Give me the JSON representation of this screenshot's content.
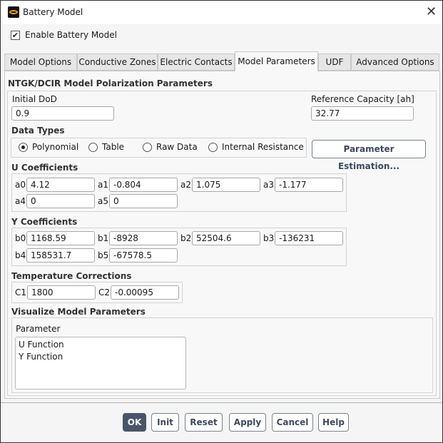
{
  "window": {
    "title": "Battery Model"
  },
  "enable": {
    "label": "Enable Battery Model",
    "checked": true
  },
  "tabs": [
    {
      "label": "Model Options"
    },
    {
      "label": "Conductive Zones"
    },
    {
      "label": "Electric Contacts"
    },
    {
      "label": "Model Parameters",
      "active": true
    },
    {
      "label": "UDF"
    },
    {
      "label": "Advanced Options"
    }
  ],
  "section_title": "NTGK/DCIR Model Polarization Parameters",
  "initial_dod": {
    "label": "Initial DoD",
    "value": "0.9"
  },
  "ref_capacity": {
    "label": "Reference Capacity [ah]",
    "value": "32.77"
  },
  "data_types": {
    "title": "Data Types",
    "options": [
      "Polynomial",
      "Table",
      "Raw Data",
      "Internal Resistance"
    ],
    "selected": "Polynomial"
  },
  "param_est_label": "Parameter Estimation...",
  "u": {
    "title": "U Coefficients",
    "fields": [
      {
        "label": "a0",
        "value": "4.12"
      },
      {
        "label": "a1",
        "value": "-0.804"
      },
      {
        "label": "a2",
        "value": "1.075"
      },
      {
        "label": "a3",
        "value": "-1.177"
      },
      {
        "label": "a4",
        "value": "0"
      },
      {
        "label": "a5",
        "value": "0"
      }
    ]
  },
  "y": {
    "title": "Y Coefficients",
    "fields": [
      {
        "label": "b0",
        "value": "1168.59"
      },
      {
        "label": "b1",
        "value": "-8928"
      },
      {
        "label": "b2",
        "value": "52504.6"
      },
      {
        "label": "b3",
        "value": "-136231"
      },
      {
        "label": "b4",
        "value": "158531.7"
      },
      {
        "label": "b5",
        "value": "-67578.5"
      }
    ]
  },
  "temp": {
    "title": "Temperature Corrections",
    "fields": [
      {
        "label": "C1",
        "value": "1800"
      },
      {
        "label": "C2",
        "value": "-0.00095"
      }
    ]
  },
  "visualize": {
    "title": "Visualize Model Parameters",
    "list_label": "Parameter",
    "items": [
      "U Function",
      "Y Function"
    ]
  },
  "buttons": {
    "ok": "OK",
    "init": "Init",
    "reset": "Reset",
    "apply": "Apply",
    "cancel": "Cancel",
    "help": "Help"
  }
}
